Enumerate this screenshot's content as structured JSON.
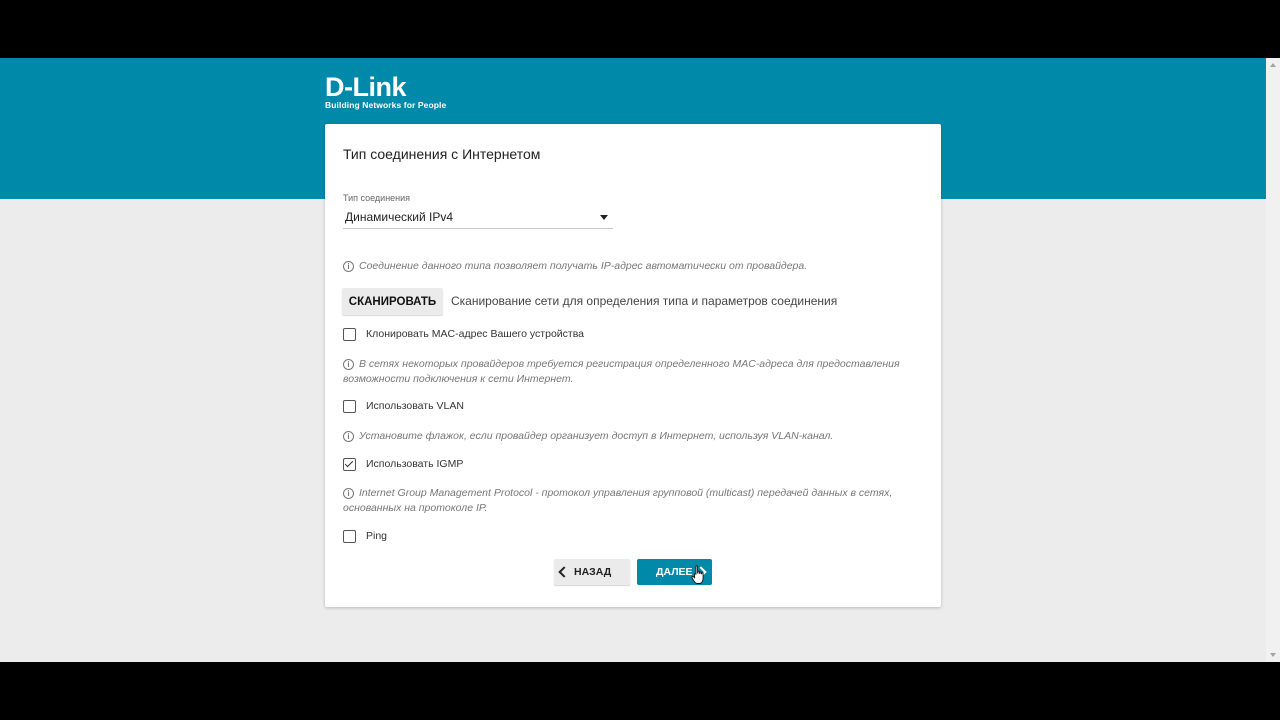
{
  "header": {
    "logo_brand": "D-Link",
    "logo_tagline": "Building Networks for People",
    "banner_color": "#0089a9"
  },
  "card": {
    "title": "Тип соединения с Интернетом",
    "connection_type": {
      "label": "Тип соединения",
      "value": "Динамический IPv4"
    },
    "connection_hint": "Соединение данного типа позволяет получать IP-адрес автоматически от провайдера.",
    "scan": {
      "button_label": "СКАНИРОВАТЬ",
      "description": "Сканирование сети для определения типа и параметров соединения"
    },
    "options": [
      {
        "label": "Клонировать MAC-адрес Вашего устройства",
        "checked": false,
        "hint": "В сетях некоторых провайдеров требуется регистрация определенного MAC-адреса для предоставления возможности подключения к сети Интернет."
      },
      {
        "label": "Использовать VLAN",
        "checked": false,
        "hint": "Установите флажок, если провайдер организует доступ в Интернет, используя VLAN-канал."
      },
      {
        "label": "Использовать IGMP",
        "checked": true,
        "hint": "Internet Group Management Protocol - протокол управления групповой (multicast) передачей данных в сетях, основанных на протоколе IP."
      },
      {
        "label": "Ping",
        "checked": false
      }
    ],
    "nav": {
      "back_label": "НАЗАД",
      "next_label": "ДАЛЕЕ"
    }
  },
  "icons": {
    "info": "info-icon",
    "select_caret": "caret-down-icon",
    "back": "chevron-left-icon",
    "next": "chevron-right-icon",
    "cursor": "hand-pointer-icon"
  }
}
